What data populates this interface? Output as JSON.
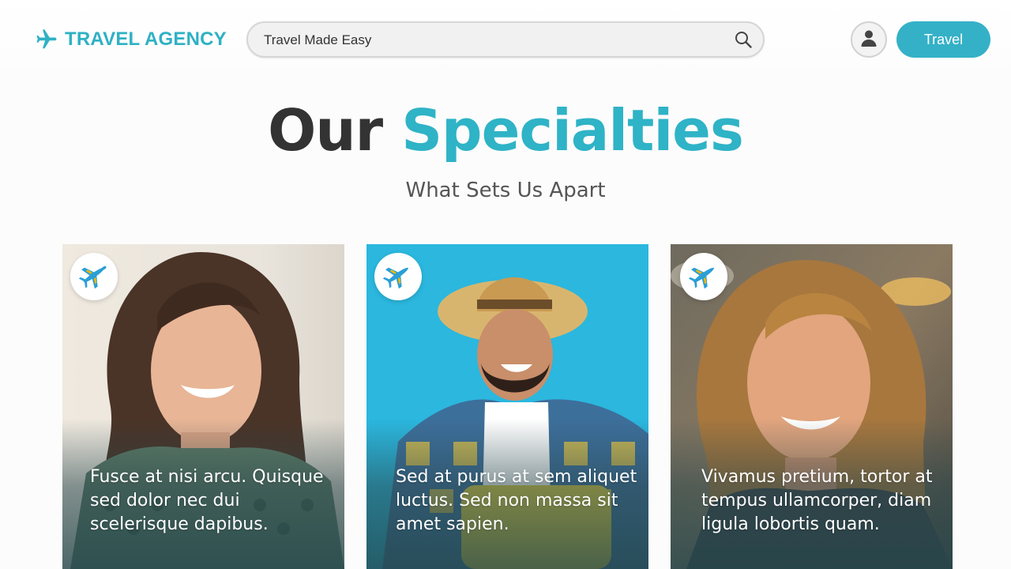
{
  "header": {
    "logo_text": "TRAVEL AGENCY",
    "logo_icon": "airplane-icon",
    "search_placeholder": "Travel Made Easy",
    "search_icon": "search-icon",
    "avatar_icon": "user-icon",
    "cta_label": "Travel"
  },
  "hero": {
    "title_part1": "Our",
    "title_part2": "Specialties",
    "subtitle": "What Sets Us Apart"
  },
  "cards": [
    {
      "caption": "Fusce at nisi arcu. Quisque sed dolor nec dui scelerisque dapibus.",
      "badge_icon": "airplane-icon"
    },
    {
      "caption": "Sed at purus at sem aliquet luctus. Sed non massa sit amet sapien.",
      "badge_icon": "airplane-icon"
    },
    {
      "caption": "Vivamus pretium, tortor at tempus ullamcorper, diam ligula lobortis quam.",
      "badge_icon": "airplane-icon"
    }
  ],
  "colors": {
    "accent": "#2fb3c6",
    "button": "#34b1c7",
    "heading_dark": "#333333",
    "badge_plane_blue": "#2a9fd6",
    "badge_plane_yellow": "#f5b800"
  }
}
